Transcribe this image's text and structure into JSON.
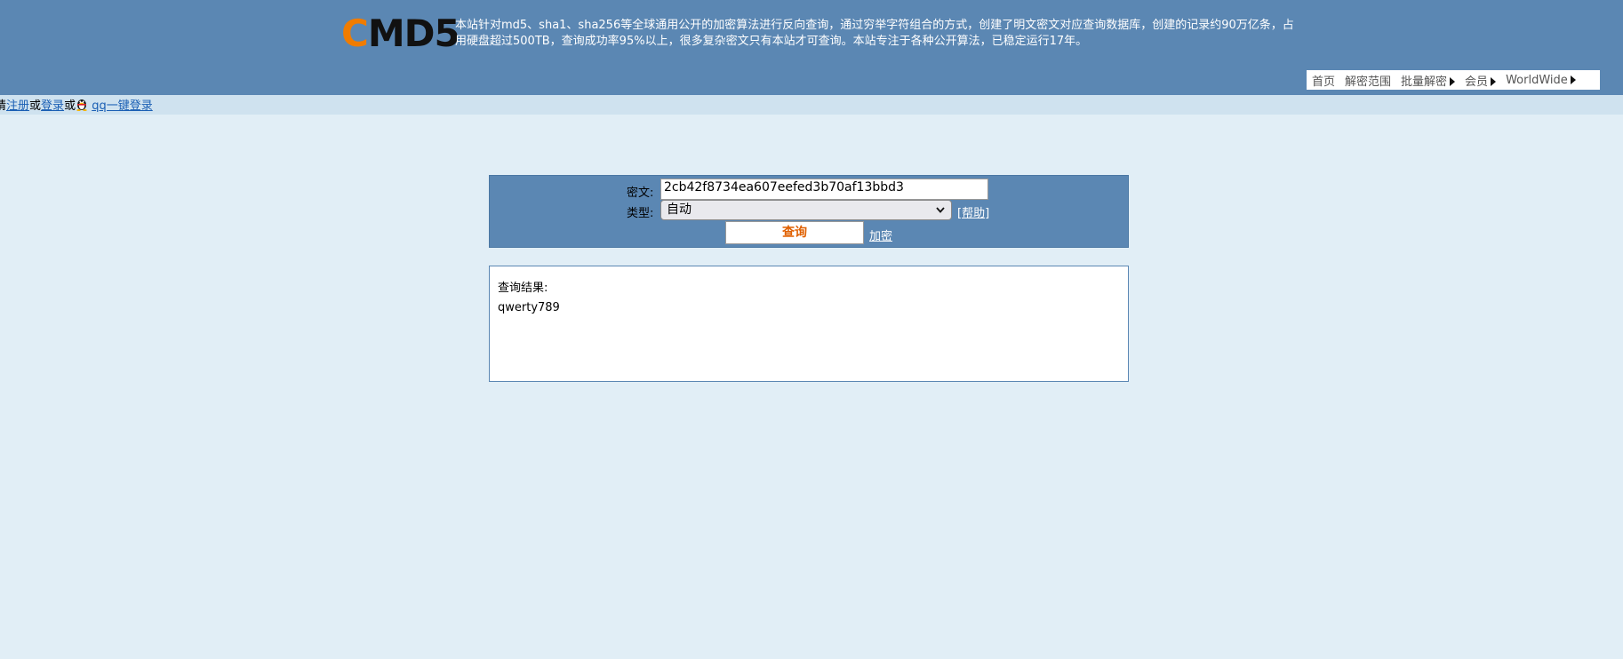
{
  "logo": {
    "c": "C",
    "rest": "MD5"
  },
  "description": "本站针对md5、sha1、sha256等全球通用公开的加密算法进行反向查询，通过穷举字符组合的方式，创建了明文密文对应查询数据库，创建的记录约90万亿条，占用硬盘超过500TB，查询成功率95%以上，很多复杂密文只有本站才可查询。本站专注于各种公开算法，已稳定运行17年。",
  "nav": [
    {
      "label": "首页",
      "arrow": false
    },
    {
      "label": "解密范围",
      "arrow": false
    },
    {
      "label": "批量解密",
      "arrow": true
    },
    {
      "label": "会员",
      "arrow": true
    },
    {
      "label": "WorldWide",
      "arrow": true
    }
  ],
  "userbar": {
    "prefix": "请",
    "register": "注册",
    "or1": "或",
    "login": "登录",
    "or2": "或",
    "qq_login": "qq一键登录"
  },
  "form": {
    "cipher_label": "密文:",
    "cipher_value": "2cb42f8734ea607eefed3b70af13bbd3",
    "type_label": "类型:",
    "type_value": "自动",
    "help": "[帮助]",
    "query_button": "查询",
    "encrypt_link": "加密"
  },
  "result": {
    "title": "查询结果:",
    "value": "qwerty789"
  },
  "colors": {
    "header_bg": "#5b87b3",
    "page_bg": "#e1eef6",
    "logo_c": "#f07c00",
    "link": "#1a5fb4"
  }
}
